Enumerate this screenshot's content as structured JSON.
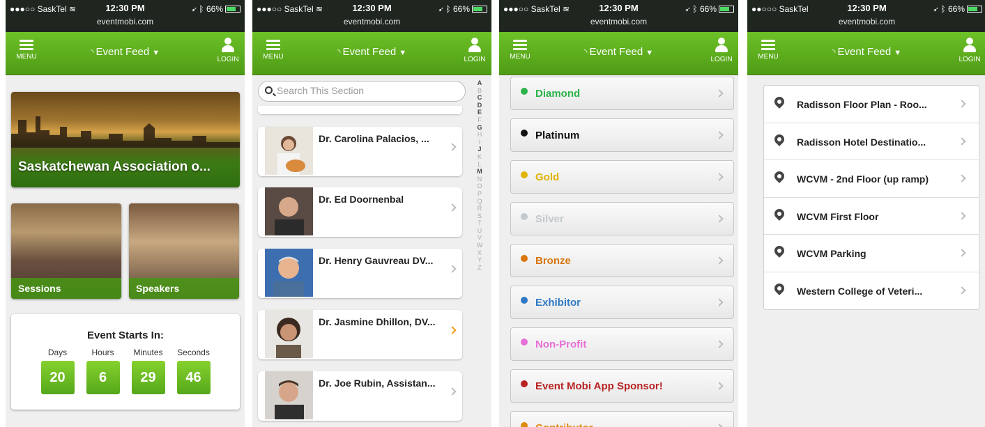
{
  "statusbar": {
    "signal": "●●●○○",
    "carrier": "SaskTel",
    "time": "12:30 PM",
    "battery": "66%",
    "url": "eventmobi.com"
  },
  "carrier_p4": "●●○○○ SaskTel",
  "nav": {
    "menu": "MENU",
    "title": "Event Feed",
    "login": "LOGIN"
  },
  "home": {
    "hero_title": "Saskatchewan Association o...",
    "tiles": [
      "Sessions",
      "Speakers"
    ],
    "countdown": {
      "title": "Event Starts In:",
      "labels": [
        "Days",
        "Hours",
        "Minutes",
        "Seconds"
      ],
      "values": [
        "20",
        "6",
        "29",
        "46"
      ]
    }
  },
  "speakers": {
    "search_placeholder": "Search This Section",
    "alphabet": [
      "A",
      "B",
      "C",
      "D",
      "E",
      "F",
      "G",
      "H",
      "I",
      "J",
      "K",
      "L",
      "M",
      "N",
      "O",
      "P",
      "Q",
      "R",
      "S",
      "T",
      "U",
      "V",
      "W",
      "X",
      "Y",
      "Z"
    ],
    "items": [
      "Dr. Carolina Palacios, ...",
      "Dr. Ed Doornenbal",
      "Dr. Henry Gauvreau DV...",
      "Dr. Jasmine Dhillon, DV...",
      "Dr. Joe Rubin, Assistan..."
    ]
  },
  "sponsors": {
    "levels": [
      {
        "name": "Diamond",
        "color": "#2db34a"
      },
      {
        "name": "Platinum",
        "color": "#111111"
      },
      {
        "name": "Gold",
        "color": "#e0b400"
      },
      {
        "name": "Silver",
        "color": "#c3c9cc"
      },
      {
        "name": "Bronze",
        "color": "#d9760c"
      },
      {
        "name": "Exhibitor",
        "color": "#2f78c4"
      },
      {
        "name": "Non-Profit",
        "color": "#e76fd8"
      },
      {
        "name": "Event Mobi App Sponsor!",
        "color": "#b82424"
      },
      {
        "name": "Contributor",
        "color": "#e08a10"
      }
    ]
  },
  "maps": {
    "items": [
      "Radisson Floor Plan - Roo...",
      "Radisson Hotel Destinatio...",
      "WCVM - 2nd Floor (up ramp)",
      "WCVM First Floor",
      "WCVM Parking",
      "Western College of Veteri..."
    ]
  }
}
